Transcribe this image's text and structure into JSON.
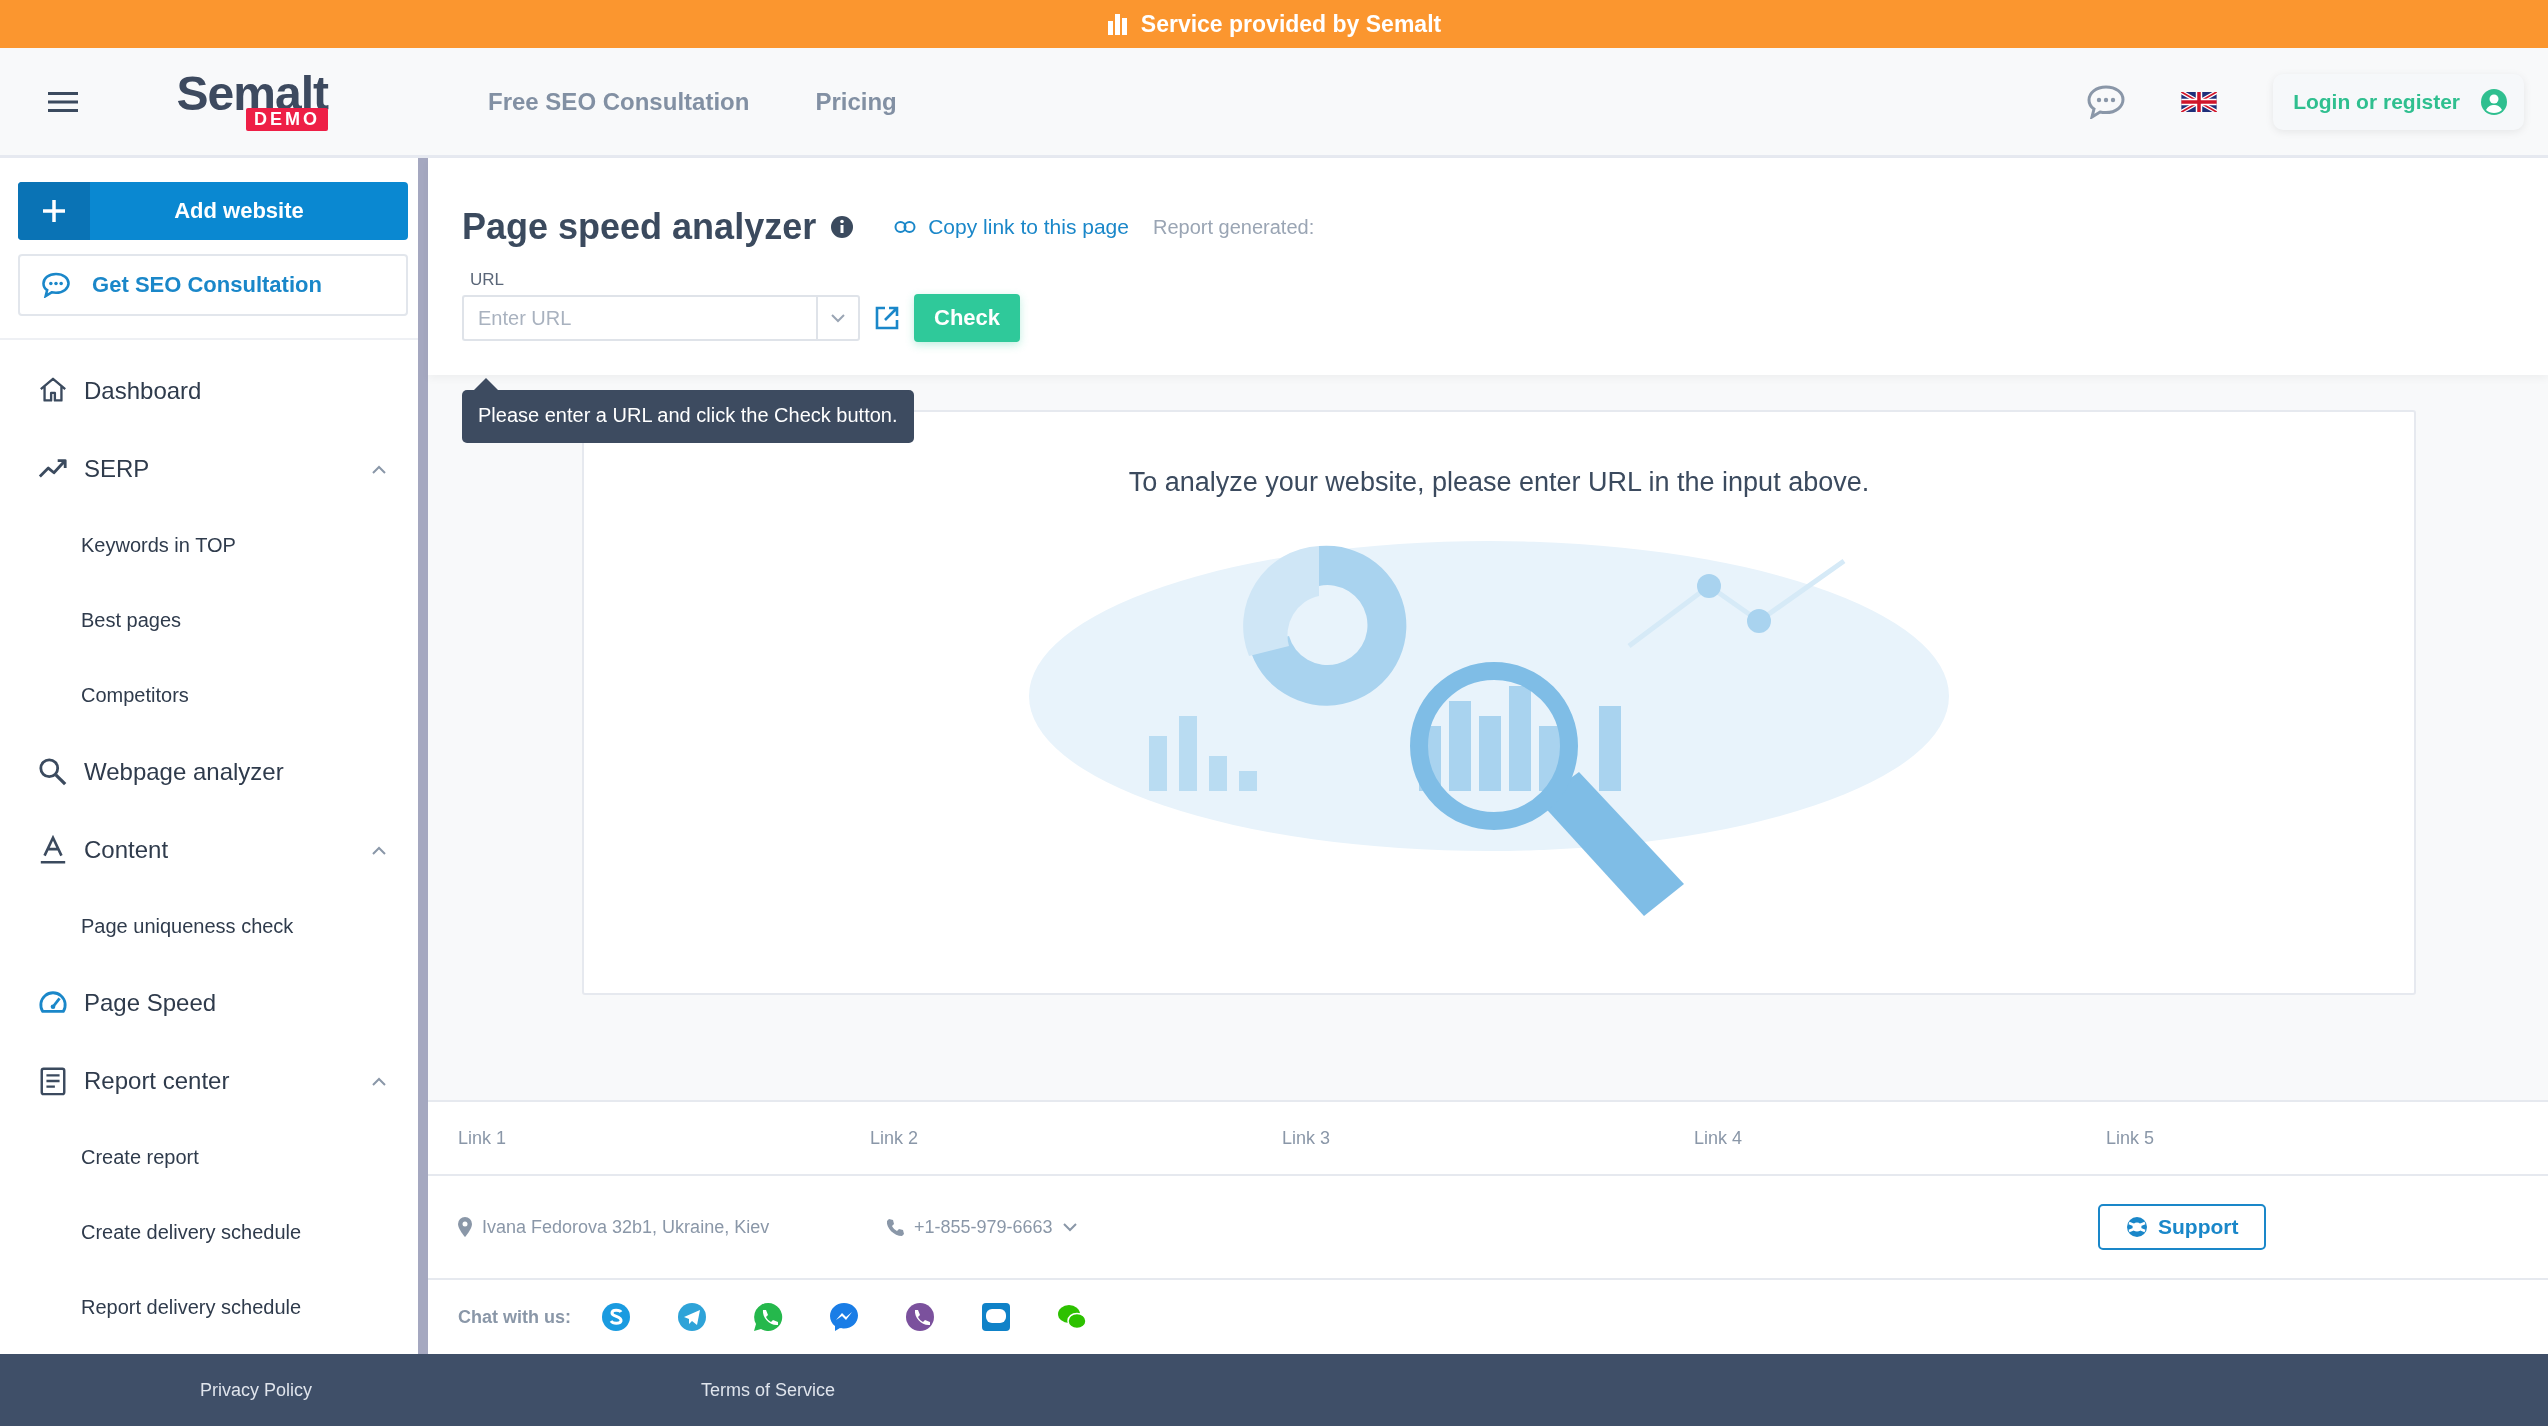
{
  "banner": {
    "text": "Service provided by Semalt"
  },
  "header": {
    "logo": "Semalt",
    "logo_badge": "DEMO",
    "links": [
      "Free SEO Consultation",
      "Pricing"
    ],
    "login": "Login or register"
  },
  "sidebar": {
    "add_button": "Add website",
    "consult_button": "Get SEO Consultation",
    "items": [
      {
        "kind": "home",
        "label": "Dashboard",
        "selected": false
      },
      {
        "kind": "trend",
        "label": "SERP",
        "selected": false,
        "expanded": true,
        "children": [
          {
            "label": "Keywords in TOP",
            "selected": false
          },
          {
            "label": "Best pages",
            "selected": false
          },
          {
            "label": "Competitors",
            "selected": false
          }
        ]
      },
      {
        "kind": "search",
        "label": "Webpage analyzer",
        "selected": false
      },
      {
        "kind": "text",
        "label": "Content",
        "selected": false,
        "expanded": true,
        "children": [
          {
            "label": "Page uniqueness check",
            "selected": false
          }
        ]
      },
      {
        "kind": "gauge",
        "label": "Page Speed",
        "selected": true
      },
      {
        "kind": "report",
        "label": "Report center",
        "selected": false,
        "expanded": true,
        "children": [
          {
            "label": "Create report",
            "selected": false
          },
          {
            "label": "Create delivery schedule",
            "selected": false
          },
          {
            "label": "Report delivery schedule",
            "selected": false
          }
        ]
      }
    ]
  },
  "page": {
    "title": "Page speed analyzer",
    "copy_link": "Copy link to this page",
    "report_label": "Report generated:",
    "url_label": "URL",
    "url_placeholder": "Enter URL",
    "check_button": "Check",
    "tooltip": "Please enter a URL and click the Check button.",
    "message": "To analyze your website, please enter URL in the input above."
  },
  "footer": {
    "links": [
      "Link 1",
      "Link 2",
      "Link 3",
      "Link 4",
      "Link 5"
    ],
    "address": "Ivana Fedorova 32b1, Ukraine, Kiev",
    "phone": "+1-855-979-6663",
    "support": "Support",
    "chat_label": "Chat with us:",
    "bottom_links": [
      "Privacy Policy",
      "Terms of Service"
    ]
  }
}
